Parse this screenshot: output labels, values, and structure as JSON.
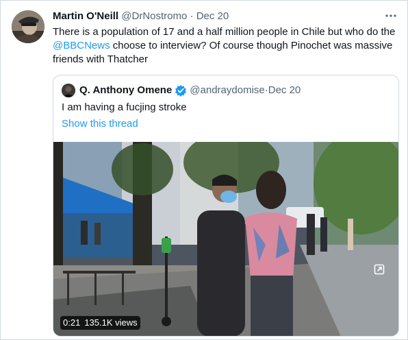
{
  "tweet": {
    "author_name": "Martin O'Neill",
    "author_handle": "@DrNostromo",
    "separator": " · ",
    "date": "Dec 20",
    "text_before": "There is a population of 17 and a half million people in Chile but who do the ",
    "mention": "@BBCNews",
    "text_after": " choose to interview? Of course though Pinochet was massive friends with Thatcher",
    "more_icon": "more-horizontal-icon"
  },
  "quote": {
    "author_name": "Q. Anthony Omene",
    "verified_icon": "verified-badge-icon",
    "author_handle": "@andraydomise",
    "separator": " · ",
    "date": "Dec 20",
    "text": "I am having a fucjing stroke",
    "show_thread": "Show this thread",
    "video": {
      "time": "0:21",
      "views": "135.1K views",
      "fullscreen_icon": "fullscreen-icon"
    }
  },
  "colors": {
    "accent": "#1d9bf0",
    "text": "#0f1419",
    "muted": "#536471",
    "border": "#cfd9de"
  }
}
